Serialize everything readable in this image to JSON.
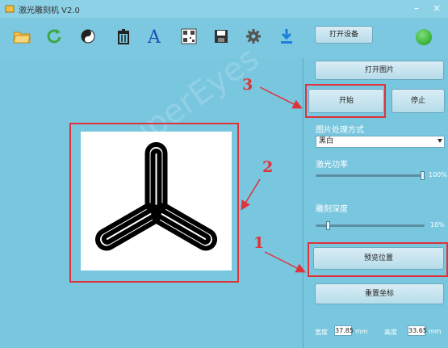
{
  "window": {
    "title": "激光雕刻机 V2.0"
  },
  "toolbar": {
    "icons": [
      "open-icon",
      "rotate-icon",
      "mirror-icon",
      "delete-icon",
      "text-icon",
      "qr-icon",
      "save-icon",
      "settings-icon",
      "download-icon"
    ],
    "open_device_label": "打开设备"
  },
  "panel": {
    "open_image_label": "打开图片",
    "start_label": "开始",
    "stop_label": "停止",
    "processing_label": "图片处理方式",
    "processing_value": "黑白",
    "laser_power_label": "激光功率",
    "laser_power_value": "100%",
    "laser_power_level": 1.0,
    "engrave_depth_label": "雕刻深度",
    "engrave_depth_value": "10%",
    "engrave_depth_level": 0.1,
    "preview_position_label": "预览位置",
    "reset_coordinates_label": "重置坐标",
    "width_label": "宽度",
    "width_value": "37.85",
    "height_label": "高度",
    "height_value": "33.65",
    "unit": "mm"
  },
  "annotations": {
    "marker1": "1",
    "marker2": "2",
    "marker3": "3"
  },
  "colors": {
    "background": "#79c6df",
    "annotation": "#e0323a",
    "status": "#1c9a1c"
  },
  "watermark": "SuperEyes"
}
